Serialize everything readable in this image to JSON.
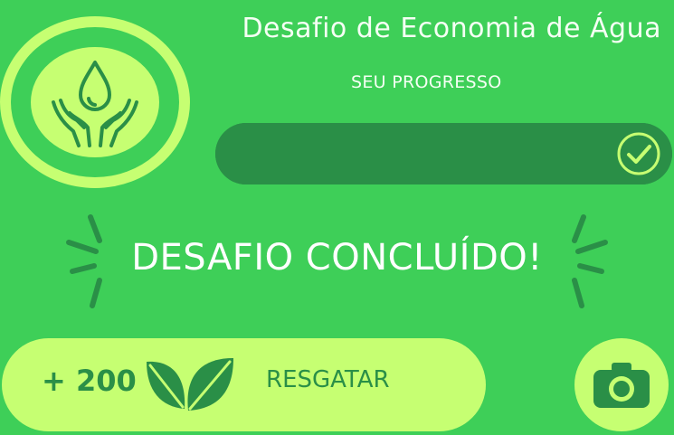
{
  "header": {
    "title": "Desafio de Economia de Água",
    "progress_label": "SEU PROGRESSO"
  },
  "progress": {
    "fraction": 1.0,
    "completed": true
  },
  "status": {
    "message": "DESAFIO CONCLUÍDO!"
  },
  "reward": {
    "amount": "+ 200",
    "redeem_label": "RESGATAR"
  },
  "icons": {
    "badge": "water-drop-hands-icon",
    "progress_complete": "check-circle-icon",
    "reward": "leaves-icon",
    "camera": "camera-icon"
  },
  "colors": {
    "background": "#3ecf58",
    "accent_light": "#c6ff72",
    "accent_dark": "#2a8f47",
    "text_light": "#f5fff4"
  }
}
